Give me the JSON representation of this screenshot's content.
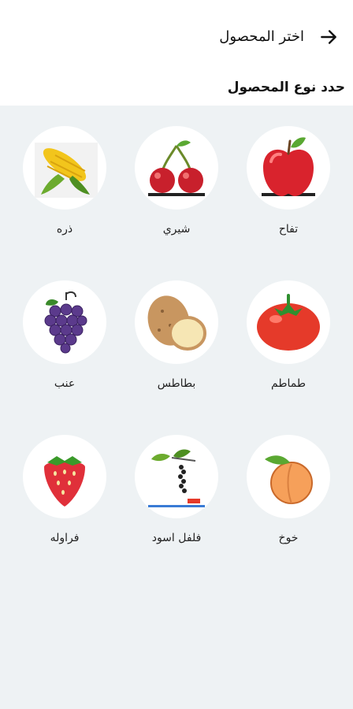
{
  "header": {
    "title": "اختر المحصول"
  },
  "subtitle": "حدد نوع المحصول",
  "crops": [
    {
      "label": "تفاح",
      "icon": "apple-icon"
    },
    {
      "label": "شيري",
      "icon": "cherry-icon"
    },
    {
      "label": "ذره",
      "icon": "corn-icon"
    },
    {
      "label": "طماطم",
      "icon": "tomato-icon"
    },
    {
      "label": "بطاطس",
      "icon": "potato-icon"
    },
    {
      "label": "عنب",
      "icon": "grape-icon"
    },
    {
      "label": "خوخ",
      "icon": "peach-icon"
    },
    {
      "label": "فلفل اسود",
      "icon": "black-pepper-icon"
    },
    {
      "label": "فراوله",
      "icon": "strawberry-icon"
    }
  ],
  "colors": {
    "grid_background": "#eef2f4",
    "card_background": "#ffffff"
  }
}
